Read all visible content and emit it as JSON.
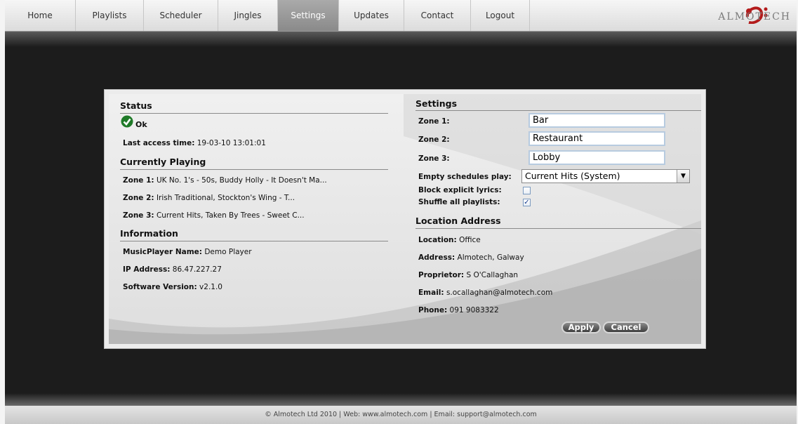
{
  "nav": {
    "items": [
      {
        "label": "Home"
      },
      {
        "label": "Playlists"
      },
      {
        "label": "Scheduler"
      },
      {
        "label": "Jingles"
      },
      {
        "label": "Settings",
        "active": true
      },
      {
        "label": "Updates"
      },
      {
        "label": "Contact"
      },
      {
        "label": "Logout"
      }
    ],
    "logo_text": "ALMOTECH"
  },
  "status": {
    "heading": "Status",
    "state": "Ok",
    "state_icon": "check-circle-icon",
    "last_access_label": "Last access time:",
    "last_access_value": "19-03-10 13:01:01"
  },
  "currently_playing": {
    "heading": "Currently Playing",
    "zones": [
      {
        "label": "Zone 1:",
        "value": "UK No. 1's - 50s, Buddy Holly - It Doesn't Ma..."
      },
      {
        "label": "Zone 2:",
        "value": "Irish Traditional, Stockton's Wing - T..."
      },
      {
        "label": "Zone 3:",
        "value": "Current Hits, Taken By Trees - Sweet C..."
      }
    ]
  },
  "information": {
    "heading": "Information",
    "rows": [
      {
        "label": "MusicPlayer Name:",
        "value": "Demo Player"
      },
      {
        "label": "IP Address:",
        "value": "86.47.227.27"
      },
      {
        "label": "Software Version:",
        "value": "v2.1.0"
      }
    ]
  },
  "settings": {
    "heading": "Settings",
    "zones": [
      {
        "label": "Zone 1:",
        "value": "Bar"
      },
      {
        "label": "Zone 2:",
        "value": "Restaurant"
      },
      {
        "label": "Zone 3:",
        "value": "Lobby"
      }
    ],
    "empty_schedules_label": "Empty schedules play:",
    "empty_schedules_value": "Current Hits (System)",
    "block_explicit_label": "Block explicit lyrics:",
    "block_explicit_checked": false,
    "shuffle_label": "Shuffle all playlists:",
    "shuffle_checked": true
  },
  "location": {
    "heading": "Location Address",
    "rows": [
      {
        "label": "Location:",
        "value": "Office"
      },
      {
        "label": "Address:",
        "value": "Almotech, Galway"
      },
      {
        "label": "Proprietor:",
        "value": "S O'Callaghan"
      },
      {
        "label": "Email:",
        "value": "s.ocallaghan@almotech.com"
      },
      {
        "label": "Phone:",
        "value": "091 9083322"
      }
    ]
  },
  "buttons": {
    "apply": "Apply",
    "cancel": "Cancel"
  },
  "footer": {
    "text": "© Almotech Ltd 2010 | Web: www.almotech.com | Email: support@almotech.com"
  }
}
